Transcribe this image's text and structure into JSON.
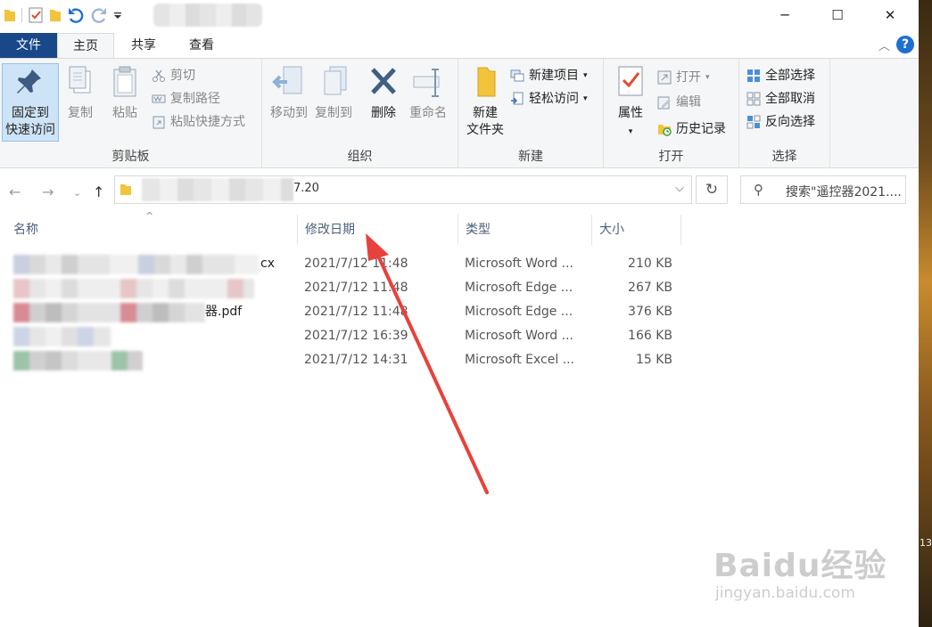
{
  "titlebar": {
    "minimize": "─",
    "maximize": "☐",
    "close": "✕"
  },
  "tabs": [
    {
      "label": "文件"
    },
    {
      "label": "主页"
    },
    {
      "label": "共享"
    },
    {
      "label": "查看"
    }
  ],
  "ribbon": {
    "clipboard": {
      "label": "剪贴板",
      "pin_line1": "固定到",
      "pin_line2": "快速访问",
      "copy": "复制",
      "paste": "粘贴",
      "cut": "剪切",
      "copy_path": "复制路径",
      "paste_shortcut": "粘贴快捷方式"
    },
    "organize": {
      "label": "组织",
      "move_to": "移动到",
      "copy_to": "复制到",
      "delete": "删除",
      "rename": "重命名"
    },
    "new": {
      "label": "新建",
      "new_folder_line1": "新建",
      "new_folder_line2": "文件夹",
      "new_item": "新建项目",
      "easy_access": "轻松访问"
    },
    "open": {
      "label": "打开",
      "properties": "属性",
      "open": "打开",
      "edit": "编辑",
      "history": "历史记录"
    },
    "select": {
      "label": "选择",
      "select_all": "全部选择",
      "select_none": "全部取消",
      "invert": "反向选择"
    }
  },
  "address": {
    "tail": "7.20"
  },
  "search": {
    "placeholder": "搜索\"遥控器2021...."
  },
  "columns": {
    "name": "名称",
    "date": "修改日期",
    "type": "类型",
    "size": "大小"
  },
  "files": [
    {
      "name_tail": "cx",
      "date": "2021/7/12 11:48",
      "type": "Microsoft Word ...",
      "size": "210 KB"
    },
    {
      "name_tail": "",
      "date": "2021/7/12 11:48",
      "type": "Microsoft Edge ...",
      "size": "267 KB"
    },
    {
      "name_tail": "器.pdf",
      "date": "2021/7/12 11:48",
      "type": "Microsoft Edge ...",
      "size": "376 KB"
    },
    {
      "name_tail": "",
      "date": "2021/7/12 16:39",
      "type": "Microsoft Word ...",
      "size": "166 KB"
    },
    {
      "name_tail": "",
      "date": "2021/7/12 14:31",
      "type": "Microsoft Excel ...",
      "size": "15 KB"
    }
  ],
  "desktop": {
    "clock_fragment": "13"
  },
  "watermark": {
    "brand": "Baidu经验",
    "site": "jingyan.baidu.com"
  },
  "colors": {
    "file_tab": "#19488a",
    "selected": "#cde4f7",
    "accent_blue": "#1e6fd1",
    "arrow": "#e8413c"
  }
}
